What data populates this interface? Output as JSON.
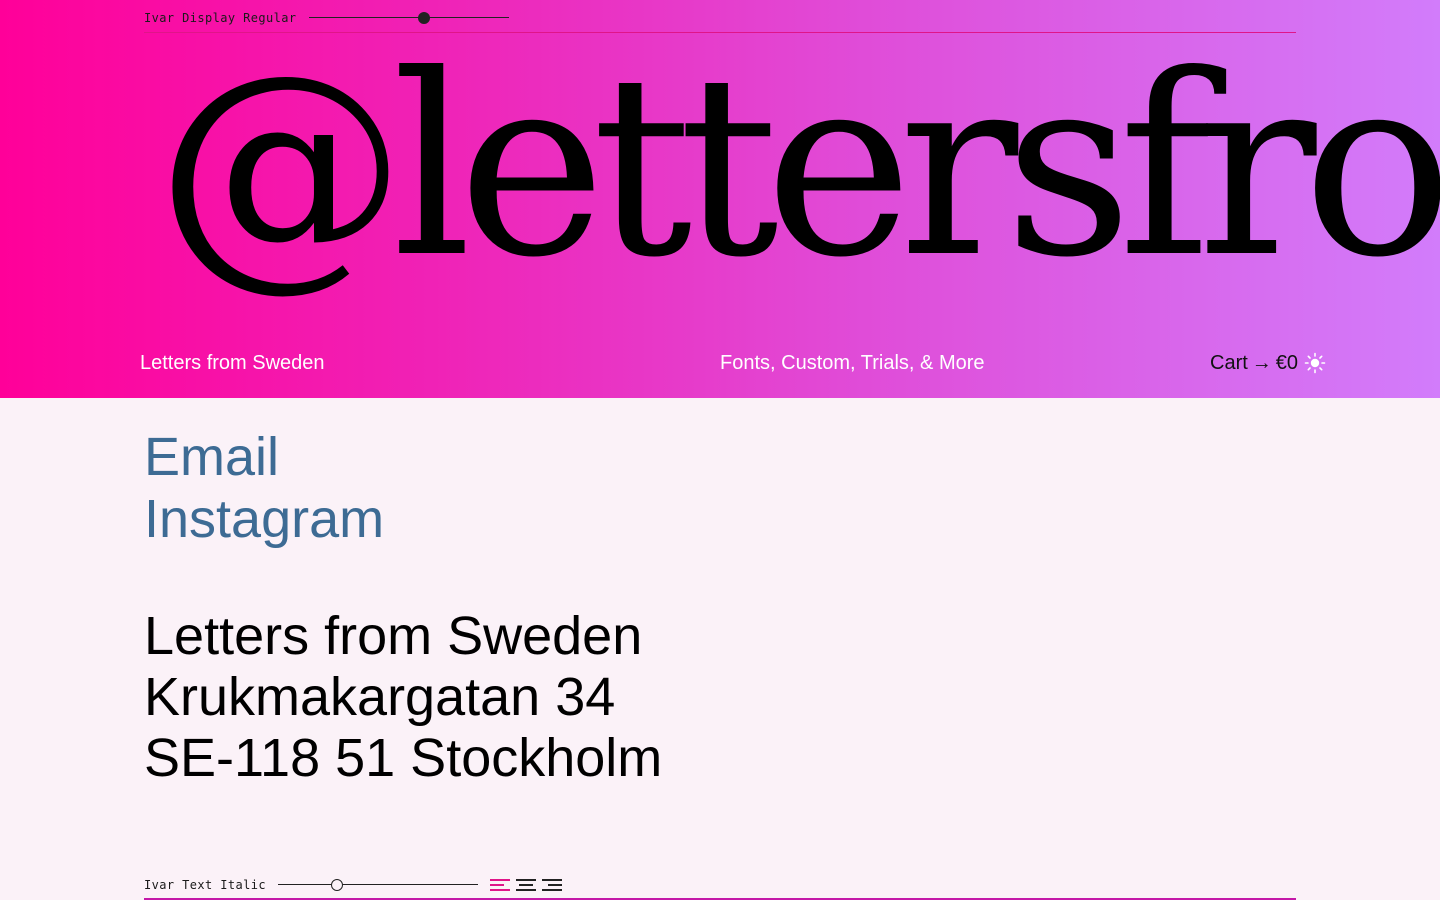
{
  "top_control": {
    "font_name": "Ivar Display Regular",
    "size_value": 0.58
  },
  "hero": {
    "headline": "@lettersfromsweden"
  },
  "nav": {
    "brand": "Letters from Sweden",
    "links": "Fonts, Custom, Trials, & More",
    "cart_label": "Cart",
    "cart_arrow": "→",
    "cart_amount": "€0",
    "theme_icon": "sun-icon"
  },
  "contact": {
    "email_label": "Email",
    "instagram_label": "Instagram"
  },
  "address": {
    "line1": "Letters from Sweden",
    "line2": "Krukmakargatan 34",
    "line3": "SE-118 51 Stockholm"
  },
  "bottom_control": {
    "font_name": "Ivar Text Italic",
    "size_value": 0.28,
    "alignment_options": [
      "left",
      "center",
      "right"
    ],
    "active_alignment": "left"
  },
  "colors": {
    "accent": "#e01589",
    "link": "#3d6b94",
    "background": "#fbf2f8",
    "gradient_start": "#ff0099",
    "gradient_end": "#d27cfb"
  }
}
